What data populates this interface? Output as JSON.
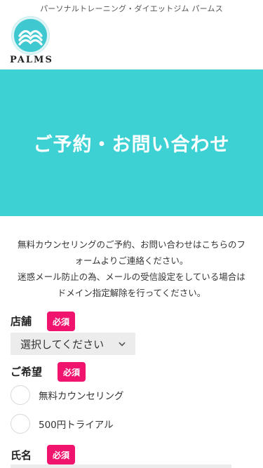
{
  "header": {
    "tagline": "パーソナルトレーニング・ダイエットジム パームス",
    "logo_text": "PALMS"
  },
  "hero": {
    "title": "ご予約・お問い合わせ",
    "background": "#3dd1d4"
  },
  "intro": {
    "lines": [
      "無料カウンセリングのご予約、お問い合わせはこちらのフ",
      "ォームよりご連絡ください。",
      "迷惑メール防止の為、メールの受信設定をしている場合は",
      "ドメイン指定解除を行ってください。"
    ]
  },
  "form": {
    "store": {
      "label": "店舗",
      "badge": "必須",
      "select_value": "選択してください"
    },
    "preference": {
      "label": "ご希望",
      "badge": "必須",
      "options": [
        "無料カウンセリング",
        "500円トライアル"
      ]
    },
    "name": {
      "label": "氏名",
      "badge": "必須"
    }
  },
  "colors": {
    "accent": "#3dd1d4",
    "required_badge": "#f0146f"
  },
  "icons": {
    "logo": "palms-wave-logo-icon",
    "select_caret": "chevron-down-icon"
  }
}
